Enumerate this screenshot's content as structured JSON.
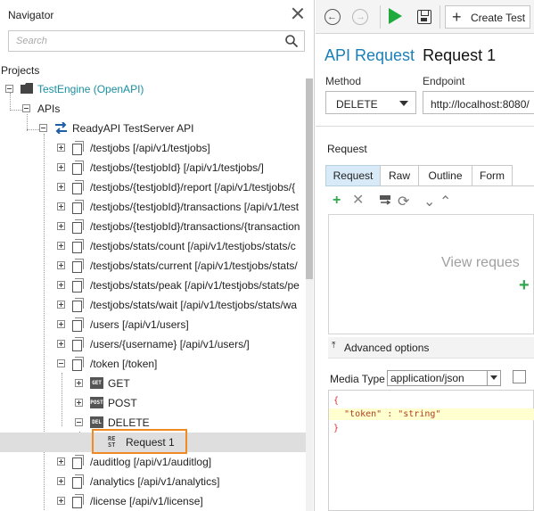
{
  "navigator": {
    "title": "Navigator",
    "search_placeholder": "Search",
    "projects_label": "Projects",
    "project": "TestEngine (OpenAPI)",
    "apis_label": "APIs",
    "api_name": "ReadyAPI TestServer API",
    "resources": [
      "/testjobs [/api/v1/testjobs]",
      "/testjobs/{testjobId} [/api/v1/testjobs/]",
      "/testjobs/{testjobId}/report [/api/v1/testjobs/{",
      "/testjobs/{testjobId}/transactions [/api/v1/test",
      "/testjobs/{testjobId}/transactions/{transaction",
      "/testjobs/stats/count [/api/v1/testjobs/stats/c",
      "/testjobs/stats/current [/api/v1/testjobs/stats/",
      "/testjobs/stats/peak [/api/v1/testjobs/stats/pe",
      "/testjobs/stats/wait [/api/v1/testjobs/stats/wa",
      "/users [/api/v1/users]",
      "/users/{username} [/api/v1/users/]",
      "/token [/token]"
    ],
    "methods": [
      {
        "badge": "GET",
        "label": "GET"
      },
      {
        "badge": "POST",
        "label": "POST"
      },
      {
        "badge": "DEL",
        "label": "DELETE"
      }
    ],
    "request": {
      "badge_top": "RE",
      "badge_bottom": "ST",
      "label": "Request 1"
    },
    "more_resources": [
      "/auditlog [/api/v1/auditlog]",
      "/analytics [/api/v1/analytics]",
      "/license [/api/v1/license]"
    ]
  },
  "toolbar": {
    "create_test_label": "Create Test"
  },
  "editor": {
    "kind": "API Request",
    "name": "Request 1",
    "method_label": "Method",
    "method_value": "DELETE",
    "endpoint_label": "Endpoint",
    "endpoint_value": "http://localhost:8080/",
    "request_section": "Request",
    "tabs": [
      "Request",
      "Raw",
      "Outline",
      "Form"
    ],
    "active_tab": "Request",
    "placeholder": "View reques",
    "advanced_options": "Advanced options",
    "media_type_label": "Media Type",
    "media_type_value": "application/json",
    "code": {
      "open": "{",
      "line": "  \"token\" : \"string\"",
      "close": "}"
    }
  },
  "colors": {
    "accent": "#1a7fb7",
    "highlight_border": "#f08a24",
    "run_green": "#1faa3b",
    "selected_row": "#dedede",
    "active_tab": "#d8eaf7"
  }
}
